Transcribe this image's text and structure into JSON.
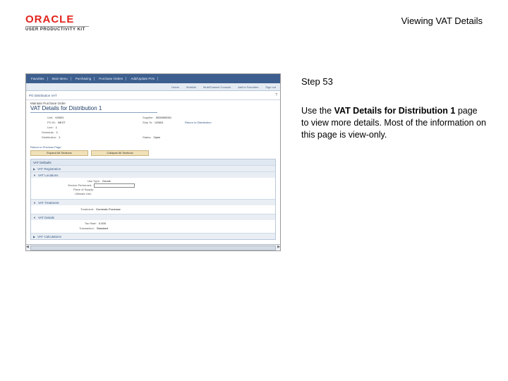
{
  "header": {
    "brand": "ORACLE",
    "product": "USER PRODUCTIVITY KIT",
    "doc_title": "Viewing VAT Details"
  },
  "step": {
    "title": "Step 53",
    "text_before": "Use the ",
    "text_bold": "VAT Details for Distribution 1",
    "text_after": " page to view more details. Most of the information on this page is view-only."
  },
  "screenshot": {
    "nav_tabs": [
      "Favorites",
      "Main Menu",
      "Purchasing",
      "Purchase Orders",
      "Add/Update POs"
    ],
    "subnav_links": [
      "Home",
      "Worklist",
      "MultiChannel Console",
      "Add to Favorites",
      "Sign out"
    ],
    "breadcrumb": "PO Distribution VAT",
    "help_icon": "help-icon",
    "page_type": "Maintain Purchase Order",
    "page_title": "VAT Details for Distribution 1",
    "fields": {
      "unit_label": "Unit:",
      "unit_value": "US001",
      "po_label": "PO ID:",
      "po_value": "NEXT",
      "line_label": "Line:",
      "line_value": "1",
      "schedule_label": "Schedule:",
      "schedule_value": "1",
      "dist_label": "Distribution:",
      "dist_value": "1",
      "supplier_label": "Supplier:",
      "supplier_value": "0000000001",
      "ship_to_label": "Ship To:",
      "ship_to_value": "US001",
      "status_label": "Status:",
      "status_value": "Open"
    },
    "link_small": "Return to Distribution",
    "return_link": "Return to Previous Page",
    "buttons": [
      "Expand All Sections",
      "Collapse All Sections"
    ],
    "sections": {
      "vat_defaults": "VAT Defaults",
      "vat_registration": "VAT Registration",
      "vat_locations": "VAT Locations",
      "vat_treatment": "VAT Treatment",
      "vat_details": "VAT Details",
      "vat_calculations": "VAT Calculations"
    },
    "vat_locations_fields": {
      "use_type_label": "Use Type:",
      "use_type_value": "Goods",
      "service_label": "Service Performed:",
      "place_label": "Place of Supply:",
      "place_value": "",
      "ultimate_label": "Ultimate Use:",
      "ultimate_value": ""
    },
    "vat_treatment_fields": {
      "treatment_label": "Treatment:",
      "treatment_value": "Domestic Purchase"
    },
    "vat_details_fields": {
      "rate_label": "Tax Rate:",
      "rate_value": "0.000",
      "transaction_label": "Transaction:",
      "transaction_value": "Standard"
    },
    "arrows": {
      "expanded": "▼",
      "collapsed": "▶"
    },
    "scroll": {
      "left": "◀",
      "right": "▶"
    }
  }
}
